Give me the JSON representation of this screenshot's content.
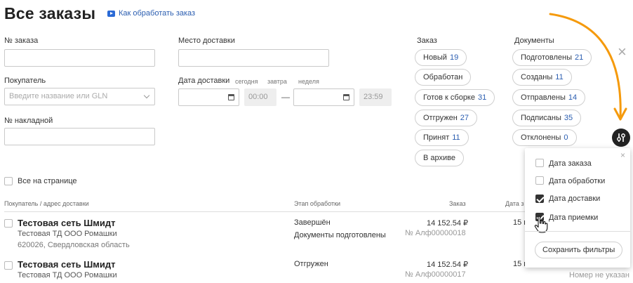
{
  "header": {
    "title": "Все заказы",
    "howto_link": "Как обработать заказ"
  },
  "filters": {
    "order_no_label": "№ заказа",
    "delivery_place_label": "Место доставки",
    "buyer_label": "Покупатель",
    "buyer_placeholder": "Введите название или GLN",
    "delivery_date_label": "Дата доставки",
    "quick_today": "сегодня",
    "quick_tomorrow": "завтра",
    "quick_week": "неделя",
    "time_from": "00:00",
    "time_dash": "—",
    "time_to": "23:59",
    "invoice_label": "№ накладной"
  },
  "order_status": {
    "title": "Заказ",
    "pills": [
      {
        "label": "Новый",
        "count": "19"
      },
      {
        "label": "Обработан",
        "count": ""
      },
      {
        "label": "Готов к сборке",
        "count": "31"
      },
      {
        "label": "Отгружен",
        "count": "27"
      },
      {
        "label": "Принят",
        "count": "11"
      },
      {
        "label": "В архиве",
        "count": ""
      }
    ]
  },
  "documents": {
    "title": "Документы",
    "pills": [
      {
        "label": "Подготовлены",
        "count": "21"
      },
      {
        "label": "Созданы",
        "count": "11"
      },
      {
        "label": "Отправлены",
        "count": "14"
      },
      {
        "label": "Подписаны",
        "count": "35"
      },
      {
        "label": "Отклонены",
        "count": "0"
      }
    ]
  },
  "select_all_label": "Все на странице",
  "table": {
    "headers": {
      "buyer": "Покупатель / адрес доставки",
      "stage": "Этап обработки",
      "order": "Заказ",
      "date": "Дата з"
    },
    "rows": [
      {
        "name": "Тестовая сеть Шмидт",
        "company": "Тестовая ТД ООО Ромашки",
        "address": "620026, Свердловская область",
        "stage": "Завершён",
        "stage2": "Документы подготовлены",
        "amount": "14 152.54 ₽",
        "number": "№ Алф00000018",
        "date": "15 м"
      },
      {
        "name": "Тестовая сеть Шмидт",
        "company": "Тестовая ТД ООО Ромашки",
        "address": "",
        "stage": "Отгружен",
        "stage2": "",
        "amount": "14 152.54 ₽",
        "number": "№ Алф00000017",
        "date": "15 м"
      }
    ],
    "number_missing": "Номер не указан"
  },
  "date_panel": {
    "options": [
      {
        "label": "Дата заказа",
        "checked": false
      },
      {
        "label": "Дата обработки",
        "checked": false
      },
      {
        "label": "Дата доставки",
        "checked": true
      },
      {
        "label": "Дата приемки",
        "checked": true
      }
    ],
    "save_label": "Сохранить фильтры"
  },
  "colors": {
    "accent_blue": "#2a5db0",
    "annotation_orange": "#f59a0c",
    "filter_button": "#222222"
  },
  "icons": [
    "play-icon",
    "calendar-icon",
    "chevron-down-icon",
    "close-icon",
    "filter-sliders-icon",
    "hand-cursor-icon",
    "arrow-annotation"
  ]
}
